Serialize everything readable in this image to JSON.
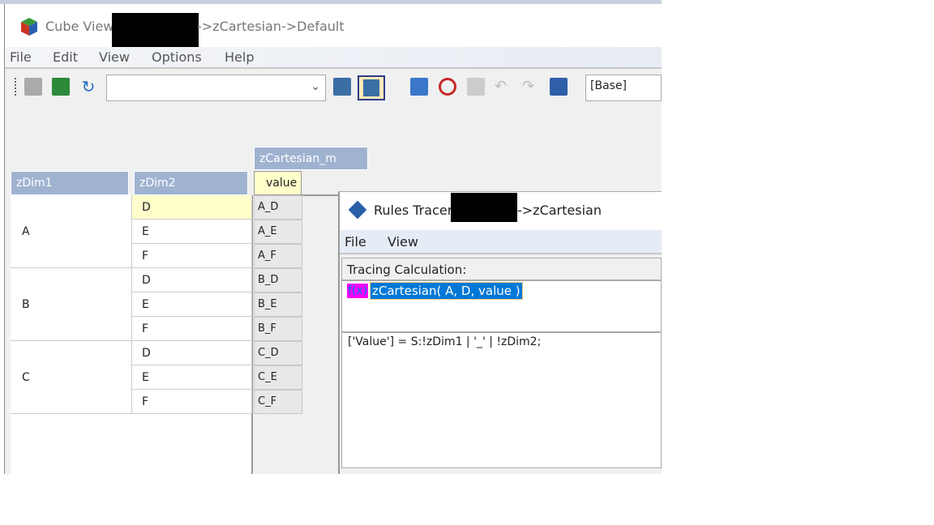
{
  "main_window": {
    "title_prefix": "Cube View",
    "title_suffix": "->zCartesian->Default",
    "menu": [
      "File",
      "Edit",
      "View",
      "Options",
      "Help"
    ],
    "toolbar": {
      "view_combo_value": "",
      "subset_combo_value": "[Base]"
    }
  },
  "grid": {
    "column_dimension": "zCartesian_m",
    "column_member": "value",
    "row_headers": [
      "zDim1",
      "zDim2"
    ],
    "dim1": [
      "A",
      "B",
      "C"
    ],
    "dim2": [
      "D",
      "E",
      "F",
      "D",
      "E",
      "F",
      "D",
      "E",
      "F"
    ],
    "values": [
      "A_D",
      "A_E",
      "A_F",
      "B_D",
      "B_E",
      "B_F",
      "C_D",
      "C_E",
      "C_F"
    ]
  },
  "rules_tracer": {
    "title_prefix": "Rules Tracer",
    "title_suffix": "->zCartesian",
    "menu": [
      "File",
      "View"
    ],
    "tracing_label": "Tracing Calculation:",
    "fx_icon": "f(x)",
    "trace_item": "zCartesian( A, D, value )",
    "rule_text": "['Value'] = S:!zDim1 | '_' | !zDim2;",
    "fx_color": "#ff00ff",
    "selection_color": "#0078d7"
  }
}
